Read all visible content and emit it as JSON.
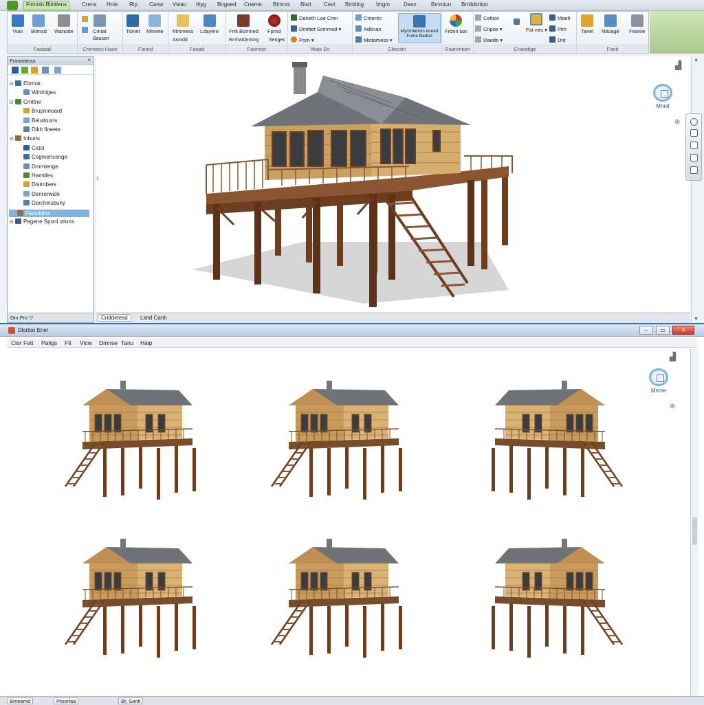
{
  "ribbon": {
    "tabs": [
      "Fimmin Blinttens",
      "Crenx",
      "Hnie",
      "Rip",
      "Canw",
      "Vieao",
      "Ihyg",
      "Bngeed",
      "Cneme",
      "Bimnrs",
      "Bistt",
      "Cevt",
      "Bmttlng",
      "Imgm",
      "Dasn",
      "Bmmiun",
      "Bmildiotion"
    ],
    "groups": [
      {
        "label": "Fastaail",
        "buttons": [
          "Vian",
          "Bitmsd",
          "Wanode"
        ]
      },
      {
        "label": "Cremees Haoe",
        "buttons": [
          "Cmiat",
          "Bausen"
        ]
      },
      {
        "label": "Fannd",
        "buttons": [
          "Tionet",
          "Mimete"
        ]
      },
      {
        "label": "Fanad",
        "buttons": [
          "Mmmess",
          "Asmdd",
          "Ldayere"
        ]
      },
      {
        "label": "Faomtor",
        "buttons": [
          "Fmt Bomned",
          "Rmhatdmning",
          "Fpmd",
          "Senges"
        ]
      },
      {
        "label": "Wats Dv",
        "buttons": [
          "Daneth Loe Cmn",
          "Dmittet Scmmod",
          "Porn"
        ]
      },
      {
        "label": "Cltecstn",
        "buttons": [
          "Cntento",
          "Adtinan",
          "Mistomess",
          "Mymmtdmts imeed",
          "Fume Badon"
        ]
      },
      {
        "label": "Raanmtom",
        "buttons": [
          "Frdnn tan"
        ]
      },
      {
        "label": "Cnandige",
        "buttons": [
          "Cetlion",
          "Cnpos",
          "Daede",
          "Fat mts",
          "Maelt",
          "Pim",
          "Dnt"
        ]
      },
      {
        "label": "Fanti",
        "buttons": [
          "Tanel",
          "Nitoage",
          "Feame"
        ]
      }
    ]
  },
  "browser": {
    "title": "Franinbeas",
    "close": "×",
    "items": [
      {
        "label": "Ebmok",
        "toggle": "⊟",
        "indent": 0
      },
      {
        "label": "Wimhiges",
        "toggle": "",
        "indent": 1
      },
      {
        "label": "Cmttne",
        "toggle": "⊟",
        "indent": 0
      },
      {
        "label": "Brupmeoard",
        "toggle": "",
        "indent": 1
      },
      {
        "label": "Beluitoons",
        "toggle": "",
        "indent": 1
      },
      {
        "label": "Dikh fineete",
        "toggle": "",
        "indent": 1
      },
      {
        "label": "Inburis",
        "toggle": "⊟",
        "indent": 0
      },
      {
        "label": "Cetol",
        "toggle": "",
        "indent": 1
      },
      {
        "label": "Cogmencenge",
        "toggle": "",
        "indent": 1
      },
      {
        "label": "Dmmienge",
        "toggle": "",
        "indent": 1
      },
      {
        "label": "Hamtiles",
        "toggle": "",
        "indent": 1
      },
      {
        "label": "Disirnbers",
        "toggle": "",
        "indent": 1
      },
      {
        "label": "Denrorwide",
        "toggle": "",
        "indent": 1
      },
      {
        "label": "Dorchinsbuny",
        "toggle": "",
        "indent": 1
      },
      {
        "label": "Fiansieliur",
        "toggle": "",
        "indent": 1,
        "selected": true
      },
      {
        "label": "Pegene Sporil otions",
        "toggle": "⊟",
        "indent": 0
      }
    ],
    "footer": "Dm Pro"
  },
  "viewport": {
    "tabs": [
      "Criddetesd",
      "Limd Canh"
    ],
    "viewcube_label": "Mnnit",
    "nav_arrow": "›"
  },
  "bottom_window": {
    "title": "Dlsrtoo Ener",
    "menu": [
      "Clor Fatt",
      "Paligs",
      "Flt",
      "Vicw",
      "Dmnse",
      "Tanu",
      "Halp"
    ],
    "viewcube_label": "Mnme",
    "status": [
      "Bmeamd",
      "Ptoorfaa",
      "Bt; Sontl"
    ],
    "window_buttons": [
      "–",
      "▭",
      "✕"
    ]
  },
  "colors": {
    "wood": "#c89a5c",
    "wood_dark": "#7a4d2a",
    "roof": "#6f7378",
    "post": "#6d3d20",
    "selection": "#7fb5e0",
    "ribbon_active": "#c9e7b1"
  }
}
